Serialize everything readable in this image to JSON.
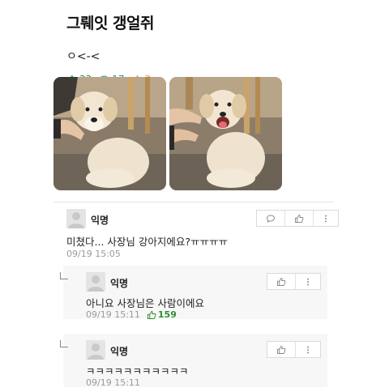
{
  "post": {
    "title": "그뤠잇 갱얼쥐",
    "body": "ㅇ<-<",
    "likes": "33",
    "comments": "17",
    "scraps": "3"
  },
  "comments": [
    {
      "nick": "익명",
      "text": "미쳤다... 사장님 강아지에요?ㅠㅠㅠㅠ",
      "time": "09/19 15:05"
    },
    {
      "nick": "익명",
      "text": "아니요 사장님은 사람이에요",
      "time": "09/19 15:11",
      "likes": "159"
    },
    {
      "nick": "익명",
      "text": "ㅋㅋㅋㅋㅋㅋㅋㅋㅋㅋㅋ",
      "time": "09/19 15:11"
    }
  ],
  "colors": {
    "likes": "#2f8f2f",
    "comments": "#2f8fa8",
    "scraps": "#d4a21a"
  },
  "icons": [
    "thumbs-up-icon",
    "comment-bubble-icon",
    "star-icon",
    "more-vertical-icon",
    "reply-arrow-icon"
  ]
}
